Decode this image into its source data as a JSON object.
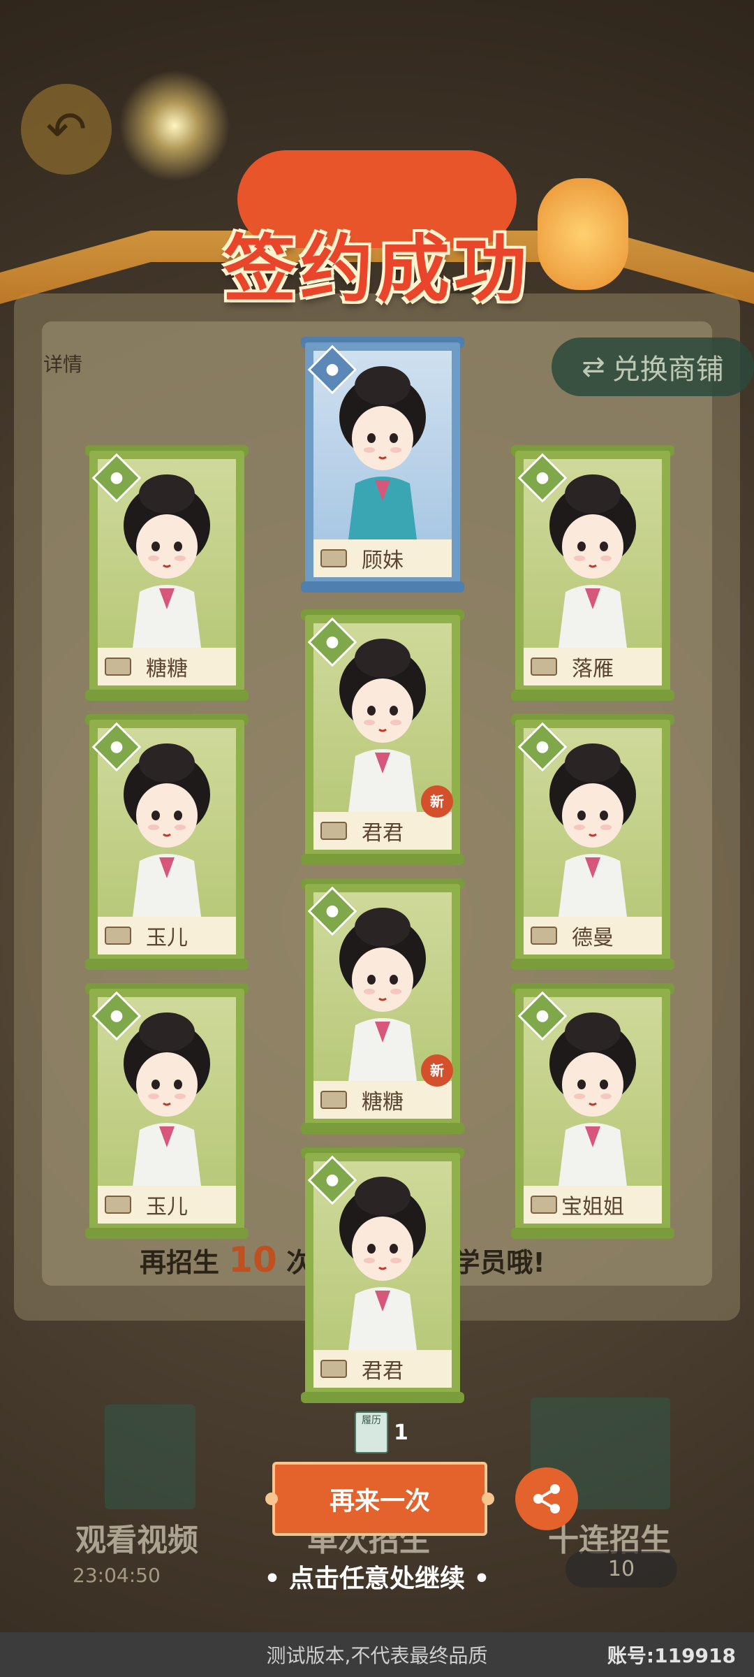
{
  "banner": {
    "title": "签约成功"
  },
  "background": {
    "detail_label": "详情",
    "shop_label": "兑换商铺",
    "recruit_hint_prefix": "再招生",
    "recruit_hint_number": "10",
    "recruit_hint_mid": "次",
    "recruit_hint_suffix": "级学员哦!",
    "watch_video_label": "观看视频",
    "video_timer": "23:04:50",
    "single_recruit_label": "单次招生",
    "ten_recruit_label": "十连招生",
    "ten_recruit_cost": "10",
    "resume_book_label": "履历"
  },
  "cards": [
    {
      "name": "顾妹",
      "rarity": "blue",
      "new": false
    },
    {
      "name": "糖糖",
      "rarity": "green",
      "new": false
    },
    {
      "name": "落雁",
      "rarity": "green",
      "new": false
    },
    {
      "name": "君君",
      "rarity": "green",
      "new": true,
      "new_label": "新"
    },
    {
      "name": "玉儿",
      "rarity": "green",
      "new": false
    },
    {
      "name": "德曼",
      "rarity": "green",
      "new": false
    },
    {
      "name": "糖糖",
      "rarity": "green",
      "new": true,
      "new_label": "新"
    },
    {
      "name": "玉儿",
      "rarity": "green",
      "new": false
    },
    {
      "name": "宝姐姐",
      "rarity": "green",
      "new": false
    },
    {
      "name": "君君",
      "rarity": "green",
      "new": false
    }
  ],
  "resume": {
    "icon_label": "履历",
    "count": "1"
  },
  "retry_button": {
    "label": "再来一次"
  },
  "continue_hint": "• 点击任意处继续 •",
  "footer": {
    "version_notice": "测试版本,不代表最终品质",
    "account": "账号:119918"
  },
  "colors": {
    "green_frame": "#8fb04a",
    "blue_frame": "#6e9cc6",
    "accent": "#e4622c"
  }
}
